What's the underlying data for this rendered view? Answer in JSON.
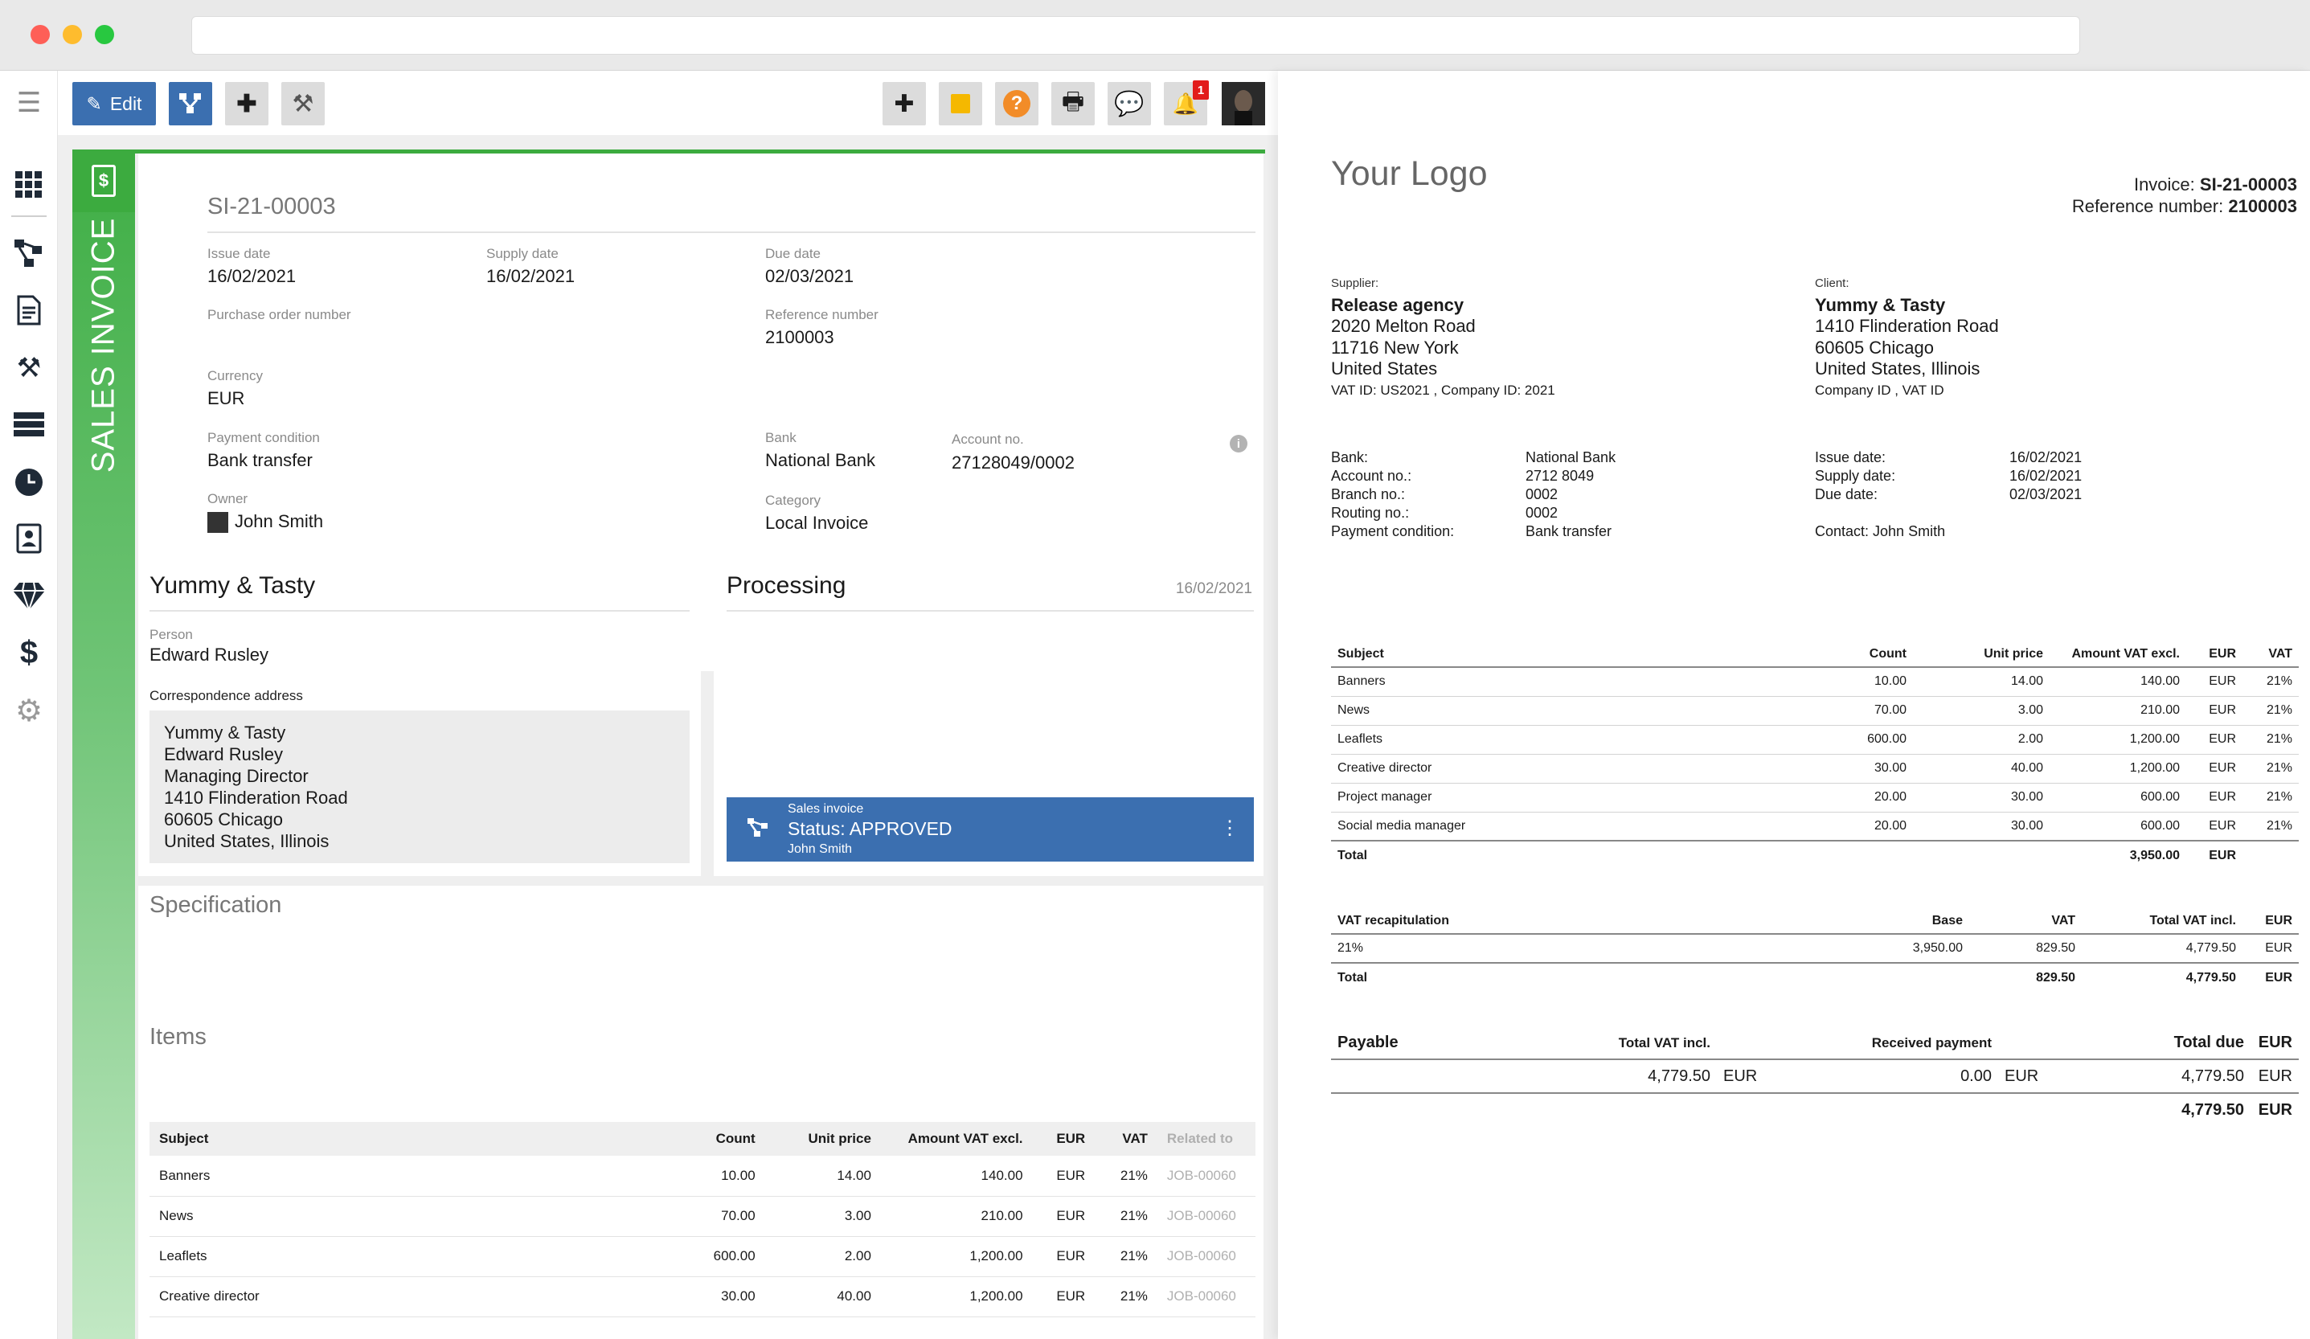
{
  "toolbar": {
    "edit_label": "Edit",
    "notification_count": "1"
  },
  "header": {
    "vertical_title": "SALES INVOICE",
    "doc_number": "SI-21-00003",
    "fields": {
      "issue_date_label": "Issue date",
      "issue_date": "16/02/2021",
      "supply_date_label": "Supply date",
      "supply_date": "16/02/2021",
      "due_date_label": "Due date",
      "due_date": "02/03/2021",
      "po_label": "Purchase order number",
      "ref_label": "Reference number",
      "ref": "2100003",
      "currency_label": "Currency",
      "currency": "EUR",
      "payment_label": "Payment condition",
      "payment": "Bank transfer",
      "bank_label": "Bank",
      "bank": "National Bank",
      "account_label": "Account no.",
      "account": "27128049/0002",
      "owner_label": "Owner",
      "owner": "John Smith",
      "category_label": "Category",
      "category": "Local Invoice"
    }
  },
  "client": {
    "name": "Yummy & Tasty",
    "person_label": "Person",
    "person": "Edward Rusley",
    "address_label": "Correspondence address",
    "address_lines": [
      "Yummy & Tasty",
      "Edward Rusley",
      "Managing Director",
      "1410 Flinderation Road",
      "60605 Chicago",
      "United States, Illinois"
    ]
  },
  "processing": {
    "title": "Processing",
    "date": "16/02/2021",
    "status_type": "Sales invoice",
    "status": "Status: APPROVED",
    "status_user": "John Smith"
  },
  "sections": {
    "specification": "Specification",
    "items": "Items"
  },
  "items_table": {
    "headers": [
      "Subject",
      "Count",
      "Unit price",
      "Amount VAT excl.",
      "EUR",
      "VAT",
      "Related to"
    ],
    "rows": [
      [
        "Banners",
        "10.00",
        "14.00",
        "140.00",
        "EUR",
        "21%",
        "JOB-00060"
      ],
      [
        "News",
        "70.00",
        "3.00",
        "210.00",
        "EUR",
        "21%",
        "JOB-00060"
      ],
      [
        "Leaflets",
        "600.00",
        "2.00",
        "1,200.00",
        "EUR",
        "21%",
        "JOB-00060"
      ],
      [
        "Creative director",
        "30.00",
        "40.00",
        "1,200.00",
        "EUR",
        "21%",
        "JOB-00060"
      ]
    ]
  },
  "preview": {
    "logo": "Your Logo",
    "invoice_label": "Invoice:",
    "invoice_no": "SI-21-00003",
    "ref_label": "Reference number:",
    "ref_no": "2100003",
    "supplier_label": "Supplier:",
    "supplier": {
      "name": "Release agency",
      "line1": "2020 Melton Road",
      "line2": "11716 New York",
      "line3": "United States",
      "ids": "VAT ID: US2021 , Company ID: 2021"
    },
    "client_label": "Client:",
    "client": {
      "name": "Yummy & Tasty",
      "line1": "1410 Flinderation Road",
      "line2": "60605 Chicago",
      "line3": "United States, Illinois",
      "ids": "Company ID  , VAT ID"
    },
    "bank_info": [
      [
        "Bank:",
        "National Bank"
      ],
      [
        "Account no.:",
        "2712 8049"
      ],
      [
        "Branch no.:",
        "0002"
      ],
      [
        "Routing no.:",
        "0002"
      ],
      [
        "Payment condition:",
        "Bank transfer"
      ]
    ],
    "dates_info": [
      [
        "Issue date:",
        "16/02/2021"
      ],
      [
        "Supply date:",
        "16/02/2021"
      ],
      [
        "Due date:",
        "02/03/2021"
      ]
    ],
    "contact": "Contact: John Smith",
    "table": {
      "headers": [
        "Subject",
        "Count",
        "Unit price",
        "Amount VAT excl.",
        "EUR",
        "VAT"
      ],
      "rows": [
        [
          "Banners",
          "10.00",
          "14.00",
          "140.00",
          "EUR",
          "21%"
        ],
        [
          "News",
          "70.00",
          "3.00",
          "210.00",
          "EUR",
          "21%"
        ],
        [
          "Leaflets",
          "600.00",
          "2.00",
          "1,200.00",
          "EUR",
          "21%"
        ],
        [
          "Creative director",
          "30.00",
          "40.00",
          "1,200.00",
          "EUR",
          "21%"
        ],
        [
          "Project manager",
          "20.00",
          "30.00",
          "600.00",
          "EUR",
          "21%"
        ],
        [
          "Social media manager",
          "20.00",
          "30.00",
          "600.00",
          "EUR",
          "21%"
        ]
      ],
      "total": [
        "Total",
        "",
        "",
        "3,950.00",
        "EUR",
        ""
      ]
    },
    "vat_table": {
      "headers": [
        "VAT recapitulation",
        "Base",
        "VAT",
        "Total VAT incl.",
        "EUR"
      ],
      "rows": [
        [
          "21%",
          "3,950.00",
          "829.50",
          "4,779.50",
          "EUR"
        ]
      ],
      "total": [
        "Total",
        "",
        "829.50",
        "4,779.50",
        "EUR"
      ]
    },
    "payable": {
      "headers": [
        "Payable",
        "Total VAT incl.",
        "",
        "Received payment",
        "",
        "Total due",
        "EUR"
      ],
      "row": [
        "",
        "4,779.50",
        "EUR",
        "0.00",
        "EUR",
        "4,779.50",
        "EUR"
      ],
      "grand": [
        "4,779.50",
        "EUR"
      ]
    }
  }
}
